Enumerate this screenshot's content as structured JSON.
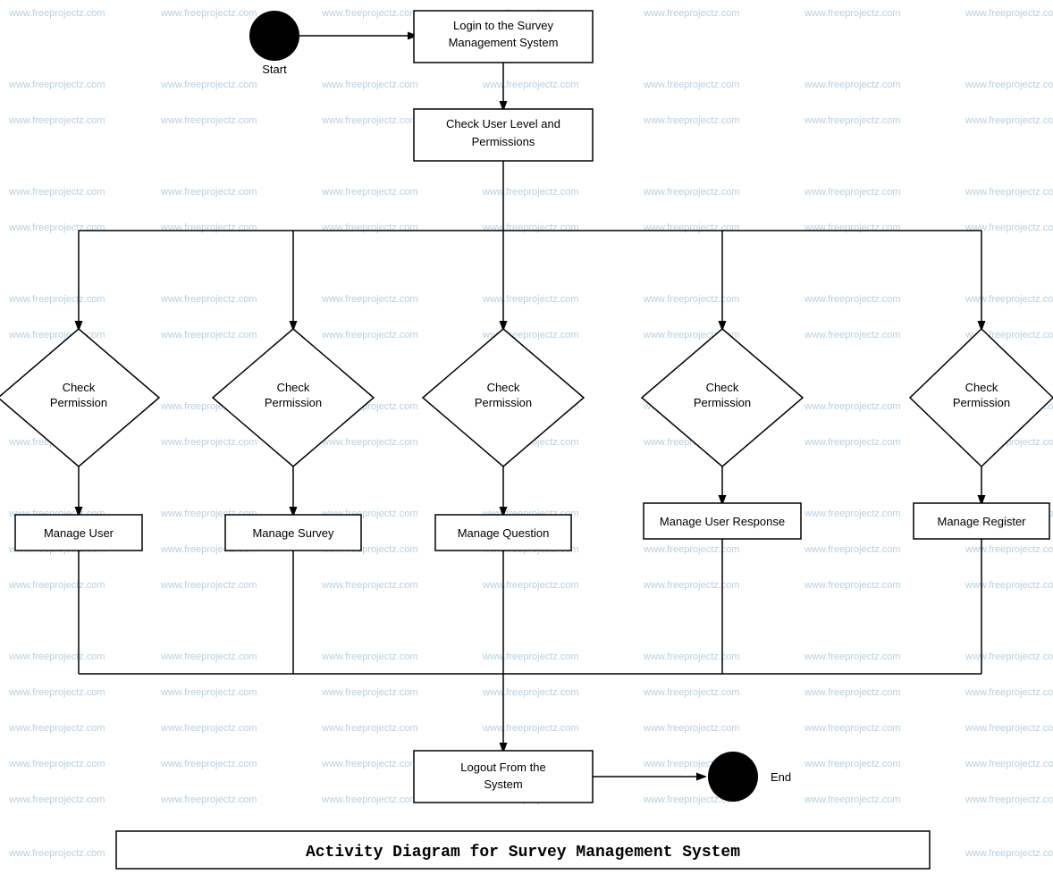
{
  "diagram": {
    "title": "Activity Diagram for Survey Management System",
    "watermark": "www.freeprojectz.com",
    "nodes": {
      "start": {
        "label": "Start"
      },
      "login": {
        "label": "Login to the Survey\nManagement System"
      },
      "checkUserLevel": {
        "label": "Check User Level and\nPermissions"
      },
      "checkPerm1": {
        "label": "Check\nPermission"
      },
      "checkPerm2": {
        "label": "Check\nPermission"
      },
      "checkPerm3": {
        "label": "Check\nPermission"
      },
      "checkPerm4": {
        "label": "Check\nPermission"
      },
      "checkPerm5": {
        "label": "Check\nPermission"
      },
      "manageUser": {
        "label": "Manage User"
      },
      "manageSurvey": {
        "label": "Manage Survey"
      },
      "manageQuestion": {
        "label": "Manage Question"
      },
      "manageUserResponse": {
        "label": "Manage User Response"
      },
      "manageRegister": {
        "label": "Manage Register"
      },
      "logout": {
        "label": "Logout From the\nSystem"
      },
      "end": {
        "label": "End"
      }
    }
  }
}
